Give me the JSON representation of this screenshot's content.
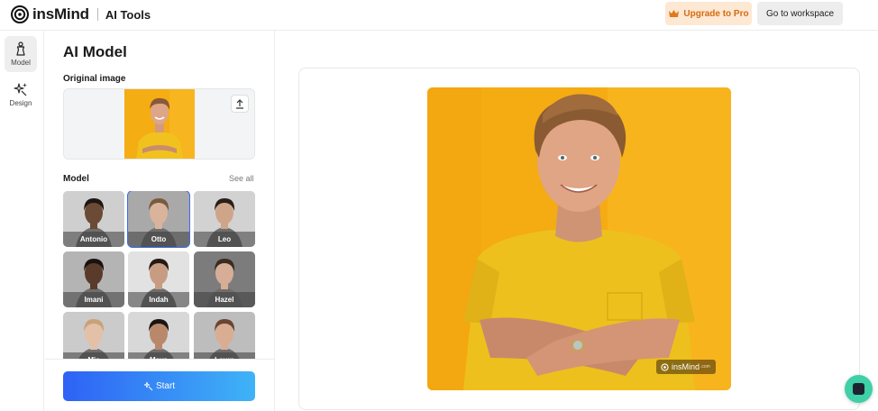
{
  "header": {
    "brand": "insMind",
    "product": "AI Tools",
    "upgrade_label": "Upgrade to Pro",
    "workspace_label": "Go to workspace"
  },
  "rail": {
    "items": [
      {
        "label": "Model",
        "icon": "model-icon",
        "active": true
      },
      {
        "label": "Design",
        "icon": "sparkle-icon",
        "active": false
      }
    ]
  },
  "panel": {
    "title": "AI Model",
    "original_label": "Original image",
    "model_label": "Model",
    "see_all": "See all",
    "models": [
      {
        "name": "Antonio",
        "skin": "#6b4a36",
        "hair": "#1e1612",
        "bg": "#cfcfcf",
        "selected": false
      },
      {
        "name": "Otto",
        "skin": "#d9b39b",
        "hair": "#7a5a3e",
        "bg": "#a9a9a9",
        "selected": true
      },
      {
        "name": "Leo",
        "skin": "#cfa58a",
        "hair": "#2a1f18",
        "bg": "#d2d2d2",
        "selected": false
      },
      {
        "name": "Imani",
        "skin": "#5a3a2a",
        "hair": "#1a1210",
        "bg": "#b4b4b4",
        "selected": false
      },
      {
        "name": "Indah",
        "skin": "#c79c82",
        "hair": "#241a15",
        "bg": "#e2e2e2",
        "selected": false
      },
      {
        "name": "Hazel",
        "skin": "#d6ad97",
        "hair": "#3a2a22",
        "bg": "#7c7c7c",
        "selected": false
      },
      {
        "name": "Mia",
        "skin": "#e3c0a8",
        "hair": "#c9a27a",
        "bg": "#cbcbcb",
        "selected": false
      },
      {
        "name": "Maya",
        "skin": "#b9876a",
        "hair": "#1c1410",
        "bg": "#d8d8d8",
        "selected": false
      },
      {
        "name": "Laura",
        "skin": "#d9ad92",
        "hair": "#6b4530",
        "bg": "#bdbdbd",
        "selected": false
      }
    ],
    "start_label": "Start"
  },
  "canvas": {
    "watermark": "insMind",
    "watermark_suffix": ".com"
  },
  "colors": {
    "accent_start": "#2e62f5",
    "accent_end": "#3fb3f7",
    "result_bg": "#f7b51c",
    "shirt": "#f1c21e",
    "upgrade_text": "#d46b10"
  }
}
